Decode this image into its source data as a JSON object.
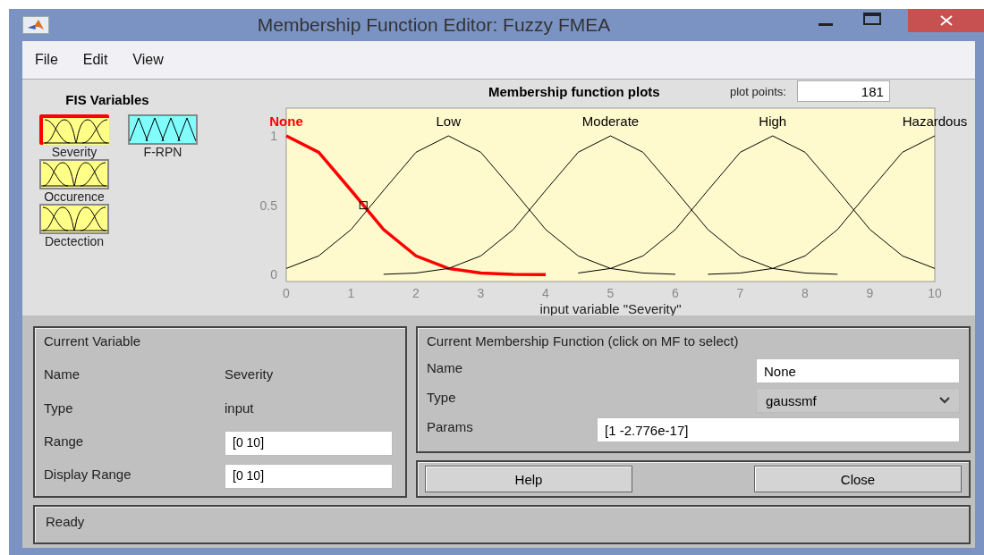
{
  "window": {
    "title": "Membership Function Editor: Fuzzy FMEA"
  },
  "menu": [
    "File",
    "Edit",
    "View"
  ],
  "fis_variables": {
    "title": "FIS Variables",
    "items": [
      {
        "name": "Severity",
        "kind": "input",
        "selected": true
      },
      {
        "name": "F-RPN",
        "kind": "output",
        "selected": false
      },
      {
        "name": "Occurence",
        "kind": "input",
        "selected": false
      },
      {
        "name": "Dectection",
        "kind": "input",
        "selected": false
      }
    ]
  },
  "plot": {
    "title": "Membership function plots",
    "plot_points_label": "plot points:",
    "plot_points": "181",
    "chart_data": {
      "type": "line",
      "xlabel": "input variable \"Severity\"",
      "x": [
        0,
        0.5,
        1,
        1.5,
        2,
        2.5,
        3,
        3.5,
        4,
        4.5,
        5,
        5.5,
        6,
        6.5,
        7,
        7.5,
        8,
        8.5,
        9,
        9.5,
        10
      ],
      "xlim": [
        0,
        10
      ],
      "ylim": [
        -0.05,
        1.2
      ],
      "xticks": [
        0,
        1,
        2,
        3,
        4,
        5,
        6,
        7,
        8,
        9,
        10
      ],
      "yticks": [
        0,
        0.5,
        1
      ],
      "series": [
        {
          "name": "None",
          "color": "#ff0000",
          "values": [
            1,
            0.882,
            0.607,
            0.325,
            0.135,
            0.044,
            0.011,
            0.002,
            0,
            null,
            null,
            null,
            null,
            null,
            null,
            null,
            null,
            null,
            null,
            null,
            null
          ]
        },
        {
          "name": "Low",
          "color": "#000000",
          "values": [
            0.044,
            0.135,
            0.325,
            0.607,
            0.882,
            1,
            0.882,
            0.607,
            0.325,
            0.135,
            0.044,
            0.011,
            0.002,
            null,
            null,
            null,
            null,
            null,
            null,
            null,
            null
          ]
        },
        {
          "name": "Moderate",
          "color": "#000000",
          "values": [
            null,
            null,
            null,
            0.002,
            0.011,
            0.044,
            0.135,
            0.325,
            0.607,
            0.882,
            1,
            0.882,
            0.607,
            0.325,
            0.135,
            0.044,
            0.011,
            0.002,
            null,
            null,
            null
          ]
        },
        {
          "name": "High",
          "color": "#000000",
          "values": [
            null,
            null,
            null,
            null,
            null,
            null,
            null,
            null,
            null,
            0.011,
            0.044,
            0.135,
            0.325,
            0.607,
            0.882,
            1,
            0.882,
            0.607,
            0.325,
            0.135,
            0.044
          ]
        },
        {
          "name": "Hazardous",
          "color": "#000000",
          "values": [
            null,
            null,
            null,
            null,
            null,
            null,
            null,
            null,
            null,
            null,
            null,
            null,
            null,
            0.002,
            0.011,
            0.044,
            0.135,
            0.325,
            0.607,
            0.882,
            1
          ]
        }
      ]
    }
  },
  "current_variable": {
    "title": "Current Variable",
    "rows": [
      {
        "label": "Name",
        "kind": "text",
        "value": "Severity"
      },
      {
        "label": "Type",
        "kind": "text",
        "value": "input"
      },
      {
        "label": "Range",
        "kind": "field",
        "value": "[0 10]"
      },
      {
        "label": "Display Range",
        "kind": "field",
        "value": "[0 10]"
      }
    ]
  },
  "current_mf": {
    "title": "Current Membership Function (click on MF to select)",
    "rows": [
      {
        "label": "Name",
        "kind": "field",
        "value": "None"
      },
      {
        "label": "Type",
        "kind": "dropdown",
        "value": "gaussmf"
      },
      {
        "label": "Params",
        "kind": "wide",
        "value": "[1 -2.776e-17]"
      }
    ]
  },
  "buttons": [
    "Help",
    "Close"
  ],
  "status_bar": "Ready"
}
